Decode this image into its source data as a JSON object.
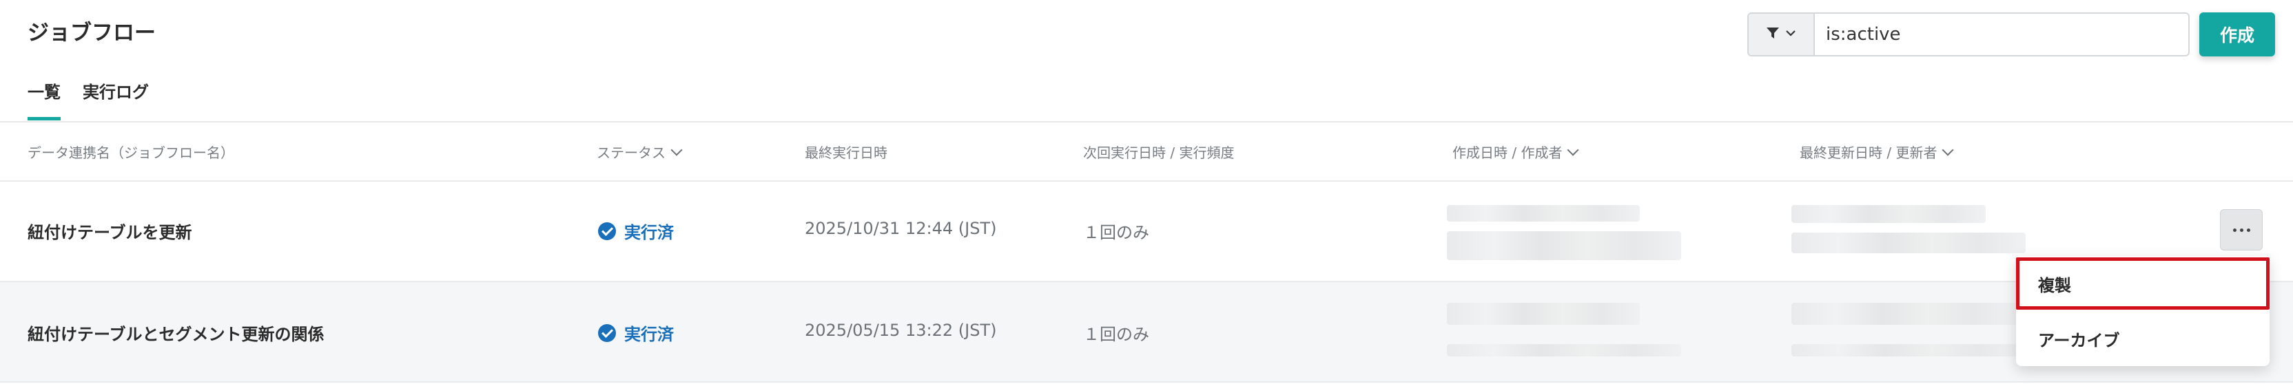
{
  "page": {
    "title": "ジョブフロー"
  },
  "toolbar": {
    "filter_icon": "filter-icon",
    "search_value": "is:active",
    "create_label": "作成",
    "accent_color": "#14a6a1"
  },
  "tabs": [
    {
      "label": "一覧",
      "active": true
    },
    {
      "label": "実行ログ",
      "active": false
    }
  ],
  "table": {
    "headers": [
      {
        "label": "データ連携名（ジョブフロー名）",
        "sortable": false
      },
      {
        "label": "ステータス",
        "sortable": true
      },
      {
        "label": "最終実行日時",
        "sortable": false
      },
      {
        "label": "次回実行日時 / 実行頻度",
        "sortable": false
      },
      {
        "label": "作成日時 / 作成者",
        "sortable": true
      },
      {
        "label": "最終更新日時 / 更新者",
        "sortable": true
      }
    ],
    "rows": [
      {
        "name": "紐付けテーブルを更新",
        "status": "実行済",
        "last_run": "2025/10/31 12:44 (JST)",
        "next_run": "１回のみ"
      },
      {
        "name": "紐付けテーブルとセグメント更新の関係",
        "status": "実行済",
        "last_run": "2025/05/15 13:22 (JST)",
        "next_run": "１回のみ"
      }
    ],
    "status_color": "#1a6fbb"
  },
  "context_menu": {
    "items": [
      {
        "label": "複製",
        "highlighted": true
      },
      {
        "label": "アーカイブ",
        "highlighted": false
      }
    ],
    "highlight_color": "#d0101a"
  }
}
